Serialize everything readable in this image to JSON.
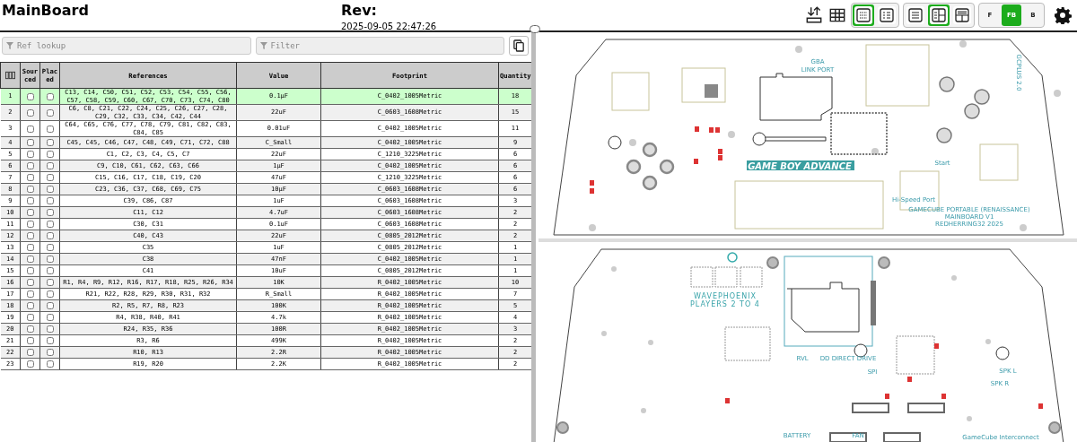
{
  "title": "MainBoard",
  "revision": {
    "label": "Rev:",
    "date": "2025-09-05 22:47:26"
  },
  "toolbar": {
    "tools": [
      {
        "kind": "upload"
      },
      {
        "kind": "grid"
      }
    ],
    "bom_view": [
      {
        "kind": "grouped",
        "selected": true
      },
      {
        "kind": "ungrouped",
        "selected": false
      }
    ],
    "layout": [
      {
        "kind": "bom-only",
        "selected": false
      },
      {
        "kind": "left-right",
        "selected": true
      },
      {
        "kind": "top-bottom",
        "selected": false
      }
    ],
    "layers": [
      {
        "label": "F",
        "selected": false
      },
      {
        "label": "FB",
        "selected": true
      },
      {
        "label": "B",
        "selected": false
      }
    ]
  },
  "filters": {
    "ref_lookup": {
      "placeholder": "Ref lookup"
    },
    "filter": {
      "placeholder": "Filter"
    }
  },
  "table": {
    "columns": [
      "Sourced",
      "Placed",
      "References",
      "Value",
      "Footprint",
      "Quantity"
    ],
    "rows": [
      {
        "index": "1",
        "sourced": false,
        "placed": false,
        "references": "C13, C14, C50, C51, C52, C53, C54, C55, C56, C57, C58, C59, C60, C67, C70, C73, C74, C80",
        "value": "0.1µF",
        "footprint": "C_0402_1005Metric",
        "quantity": "18",
        "selected": true
      },
      {
        "index": "2",
        "sourced": false,
        "placed": false,
        "references": "C6, C8, C21, C22, C24, C25, C26, C27, C28, C29, C32, C33, C34, C42, C44",
        "value": "22uF",
        "footprint": "C_0603_1608Metric",
        "quantity": "15",
        "selected": false
      },
      {
        "index": "3",
        "sourced": false,
        "placed": false,
        "references": "C64, C65, C76, C77, C78, C79, C81, C82, C83, C84, C85",
        "value": "0.01uF",
        "footprint": "C_0402_1005Metric",
        "quantity": "11",
        "selected": false
      },
      {
        "index": "4",
        "sourced": false,
        "placed": false,
        "references": "C45, C45, C46, C47, C48, C49, C71, C72, C88",
        "value": "C_Small",
        "footprint": "C_0402_1005Metric",
        "quantity": "9",
        "selected": false
      },
      {
        "index": "5",
        "sourced": false,
        "placed": false,
        "references": "C1, C2, C3, C4, C5, C7",
        "value": "22uF",
        "footprint": "C_1210_3225Metric",
        "quantity": "6",
        "selected": false
      },
      {
        "index": "6",
        "sourced": false,
        "placed": false,
        "references": "C9, C10, C61, C62, C63, C66",
        "value": "1µF",
        "footprint": "C_0402_1005Metric",
        "quantity": "6",
        "selected": false
      },
      {
        "index": "7",
        "sourced": false,
        "placed": false,
        "references": "C15, C16, C17, C18, C19, C20",
        "value": "47uF",
        "footprint": "C_1210_3225Metric",
        "quantity": "6",
        "selected": false
      },
      {
        "index": "8",
        "sourced": false,
        "placed": false,
        "references": "C23, C36, C37, C68, C69, C75",
        "value": "10µF",
        "footprint": "C_0603_1608Metric",
        "quantity": "6",
        "selected": false
      },
      {
        "index": "9",
        "sourced": false,
        "placed": false,
        "references": "C39, C86, C87",
        "value": "1uF",
        "footprint": "C_0603_1608Metric",
        "quantity": "3",
        "selected": false
      },
      {
        "index": "10",
        "sourced": false,
        "placed": false,
        "references": "C11, C12",
        "value": "4.7uF",
        "footprint": "C_0603_1608Metric",
        "quantity": "2",
        "selected": false
      },
      {
        "index": "11",
        "sourced": false,
        "placed": false,
        "references": "C30, C31",
        "value": "0.1uF",
        "footprint": "C_0603_1608Metric",
        "quantity": "2",
        "selected": false
      },
      {
        "index": "12",
        "sourced": false,
        "placed": false,
        "references": "C40, C43",
        "value": "22uF",
        "footprint": "C_0805_2012Metric",
        "quantity": "2",
        "selected": false
      },
      {
        "index": "13",
        "sourced": false,
        "placed": false,
        "references": "C35",
        "value": "1uF",
        "footprint": "C_0805_2012Metric",
        "quantity": "1",
        "selected": false
      },
      {
        "index": "14",
        "sourced": false,
        "placed": false,
        "references": "C38",
        "value": "47nF",
        "footprint": "C_0402_1005Metric",
        "quantity": "1",
        "selected": false
      },
      {
        "index": "15",
        "sourced": false,
        "placed": false,
        "references": "C41",
        "value": "10uF",
        "footprint": "C_0805_2012Metric",
        "quantity": "1",
        "selected": false
      },
      {
        "index": "16",
        "sourced": false,
        "placed": false,
        "references": "R1, R4, R9, R12, R16, R17, R18, R25, R26, R34",
        "value": "10K",
        "footprint": "R_0402_1005Metric",
        "quantity": "10",
        "selected": false
      },
      {
        "index": "17",
        "sourced": false,
        "placed": false,
        "references": "R21, R22, R28, R29, R30, R31, R32",
        "value": "R_Small",
        "footprint": "R_0402_1005Metric",
        "quantity": "7",
        "selected": false
      },
      {
        "index": "18",
        "sourced": false,
        "placed": false,
        "references": "R2, R5, R7, R8, R23",
        "value": "100K",
        "footprint": "R_0402_1005Metric",
        "quantity": "5",
        "selected": false
      },
      {
        "index": "19",
        "sourced": false,
        "placed": false,
        "references": "R4, R38, R40, R41",
        "value": "4.7k",
        "footprint": "R_0402_1005Metric",
        "quantity": "4",
        "selected": false
      },
      {
        "index": "20",
        "sourced": false,
        "placed": false,
        "references": "R24, R35, R36",
        "value": "100R",
        "footprint": "R_0402_1005Metric",
        "quantity": "3",
        "selected": false
      },
      {
        "index": "21",
        "sourced": false,
        "placed": false,
        "references": "R3, R6",
        "value": "499K",
        "footprint": "R_0402_1005Metric",
        "quantity": "2",
        "selected": false
      },
      {
        "index": "22",
        "sourced": false,
        "placed": false,
        "references": "R10, R13",
        "value": "2.2R",
        "footprint": "R_0402_1005Metric",
        "quantity": "2",
        "selected": false
      },
      {
        "index": "23",
        "sourced": false,
        "placed": false,
        "references": "R19, R20",
        "value": "2.2K",
        "footprint": "R_0402_1005Metric",
        "quantity": "2",
        "selected": false
      }
    ]
  },
  "boards": [
    {
      "labels": [
        {
          "text": "GBA",
          "kind": "plain"
        },
        {
          "text": "LINK PORT",
          "kind": "plain"
        },
        {
          "text": "GCPLUS 2.0",
          "kind": "vertical"
        },
        {
          "text": "GAME BOY ADVANCE",
          "kind": "logo"
        },
        {
          "text": "Start",
          "kind": "plain"
        },
        {
          "text": "Hi-Speed Port",
          "kind": "plain"
        },
        {
          "text": "GAMECUBE PORTABLE (RENAISSANCE)",
          "kind": "plain"
        },
        {
          "text": "MAINBOARD V1",
          "kind": "plain"
        },
        {
          "text": "REDHERRING32 2025",
          "kind": "plain"
        }
      ]
    },
    {
      "labels": [
        {
          "text": "WAVEPHOENIX",
          "kind": "title"
        },
        {
          "text": "PLAYERS 2 TO 4",
          "kind": "title"
        },
        {
          "text": "RVL",
          "kind": "plain"
        },
        {
          "text": "DD DIRECT DRIVE",
          "kind": "plain"
        },
        {
          "text": "SPI",
          "kind": "plain"
        },
        {
          "text": "SPK L",
          "kind": "plain"
        },
        {
          "text": "SPK R",
          "kind": "plain"
        },
        {
          "text": "BATTERY",
          "kind": "plain"
        },
        {
          "text": "FAN",
          "kind": "plain"
        },
        {
          "text": "GameCube Interconnect",
          "kind": "plain"
        }
      ]
    }
  ]
}
